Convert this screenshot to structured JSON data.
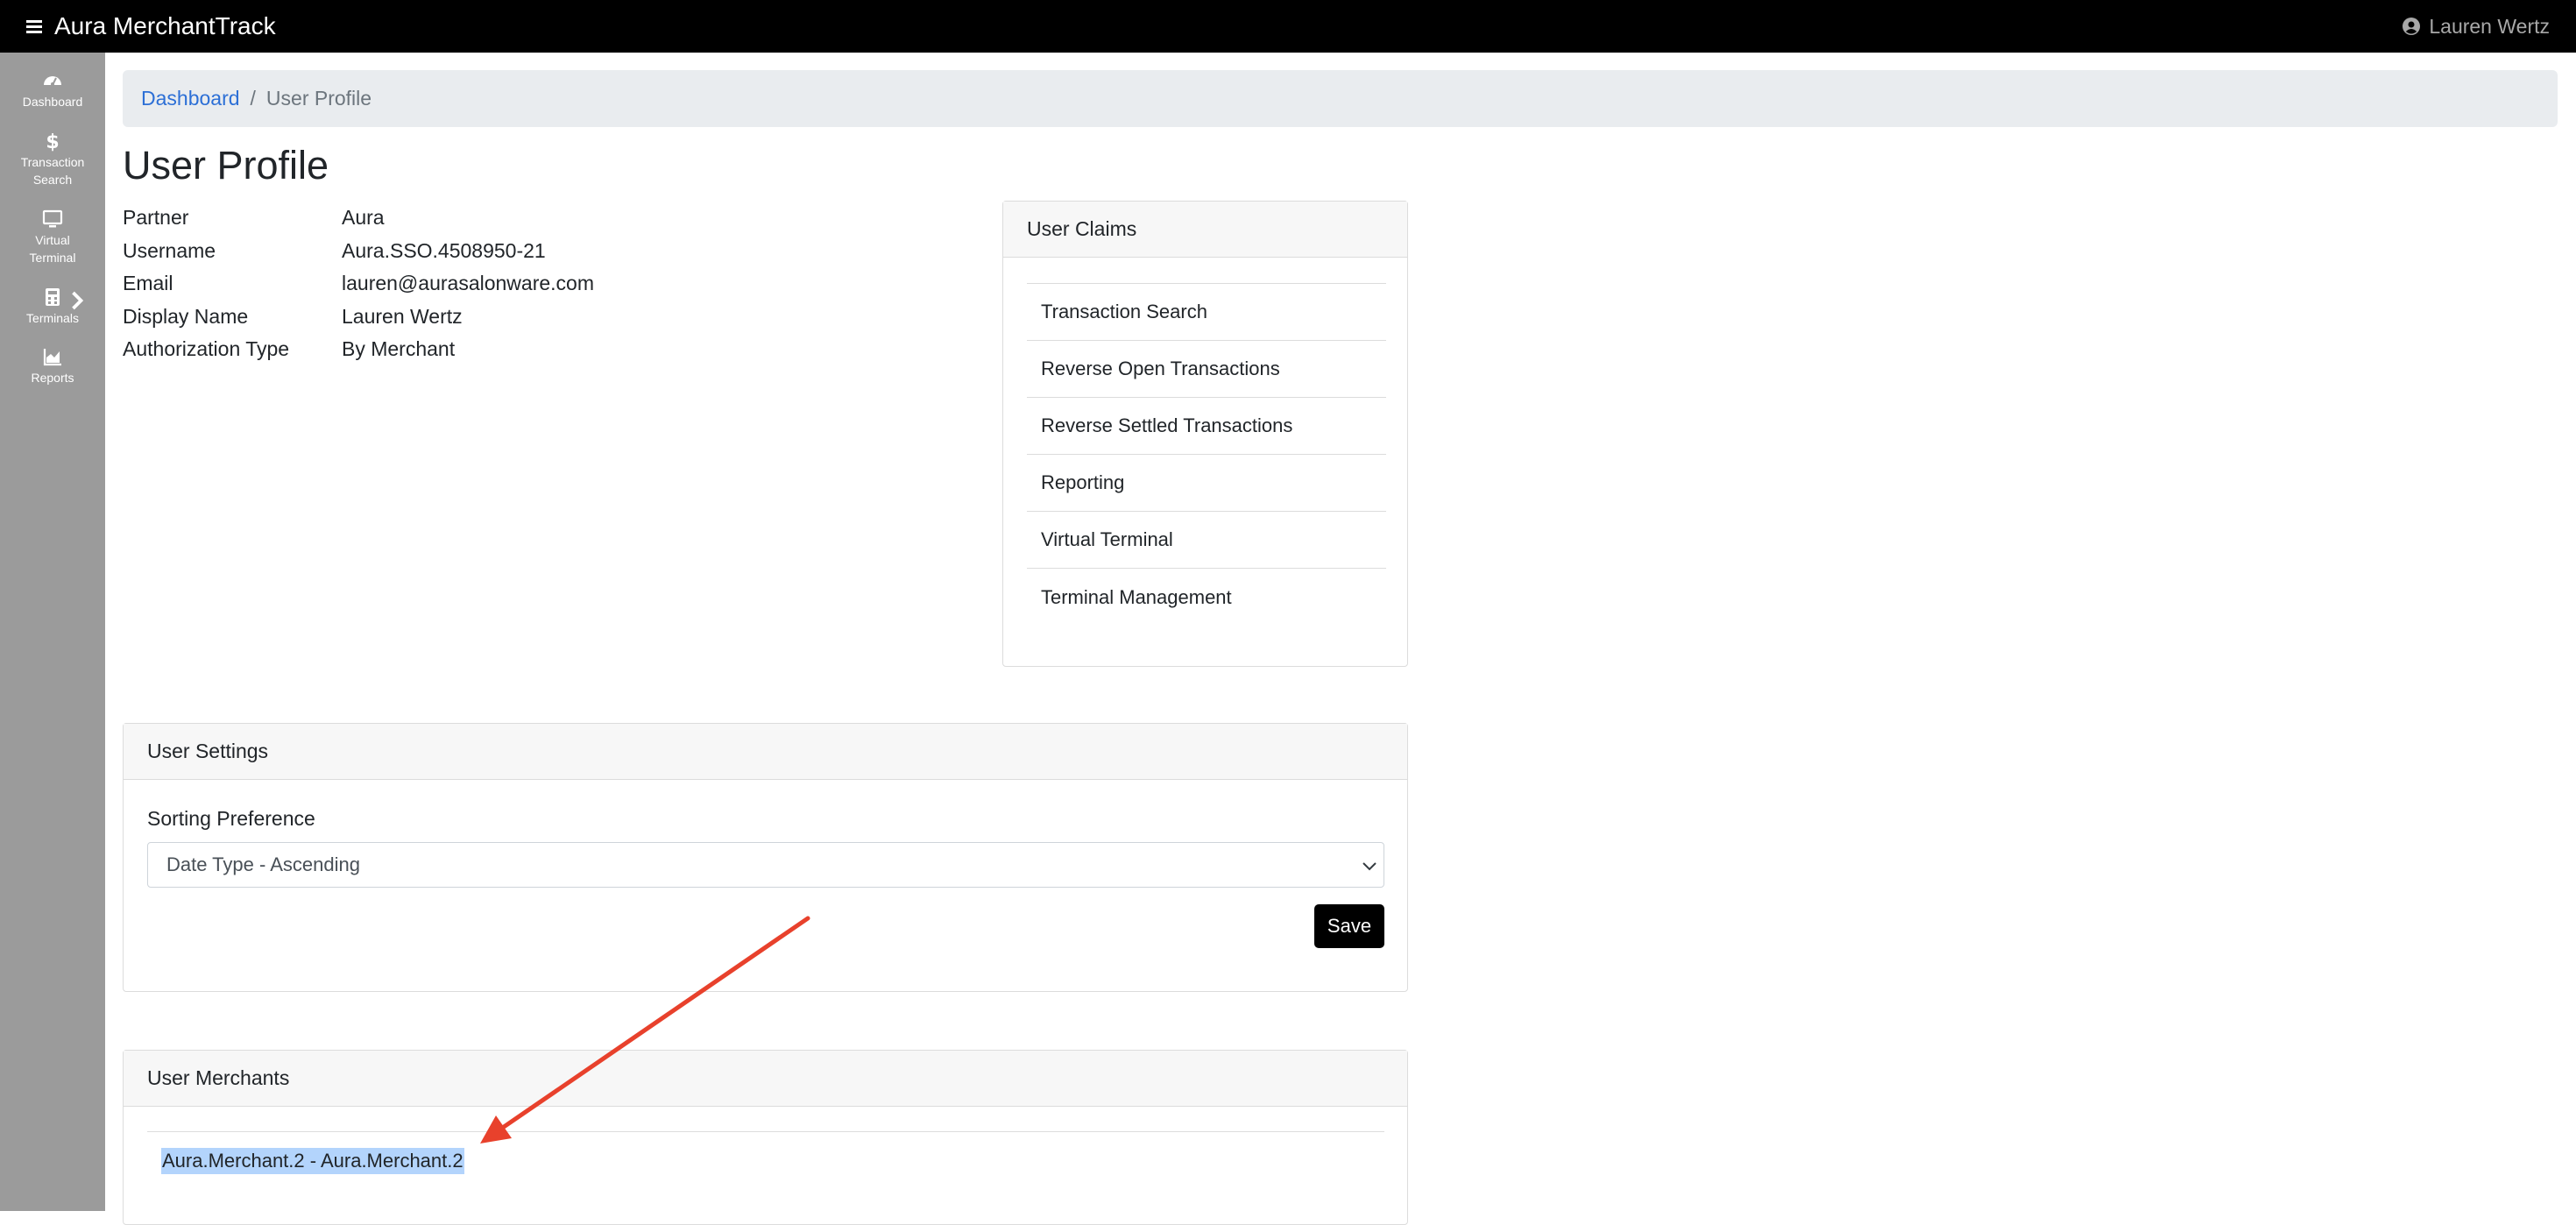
{
  "app": {
    "title": "Aura MerchantTrack",
    "user_name": "Lauren Wertz"
  },
  "sidebar": {
    "items": [
      {
        "label": "Dashboard",
        "icon": "dashboard-icon"
      },
      {
        "label": "Transaction\nSearch",
        "icon": "dollar-icon"
      },
      {
        "label": "Virtual\nTerminal",
        "icon": "monitor-icon"
      },
      {
        "label": "Terminals",
        "icon": "calculator-icon"
      },
      {
        "label": "Reports",
        "icon": "chart-area-icon"
      }
    ]
  },
  "breadcrumb": {
    "home": "Dashboard",
    "separator": "/",
    "current": "User Profile"
  },
  "page": {
    "title": "User Profile"
  },
  "profile": [
    {
      "label": "Partner",
      "value": "Aura"
    },
    {
      "label": "Username",
      "value": "Aura.SSO.4508950-21"
    },
    {
      "label": "Email",
      "value": "lauren@aurasalonware.com"
    },
    {
      "label": "Display Name",
      "value": "Lauren Wertz"
    },
    {
      "label": "Authorization Type",
      "value": "By Merchant"
    }
  ],
  "claims": {
    "title": "User Claims",
    "items": [
      "Transaction Search",
      "Reverse Open Transactions",
      "Reverse Settled Transactions",
      "Reporting",
      "Virtual Terminal",
      "Terminal Management"
    ]
  },
  "settings": {
    "title": "User Settings",
    "sort_label": "Sorting Preference",
    "sort_value": "Date Type - Ascending",
    "save_label": "Save"
  },
  "merchants": {
    "title": "User Merchants",
    "items": [
      "Aura.Merchant.2 - Aura.Merchant.2"
    ]
  },
  "colors": {
    "topbar": "#000000",
    "sidebar": "#9b9b9b",
    "link": "#2c6fd6",
    "annotation_arrow": "#e8412c",
    "selection": "#b3d4fc"
  }
}
